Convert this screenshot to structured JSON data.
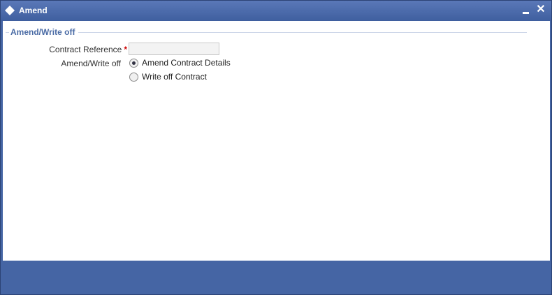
{
  "window": {
    "title": "Amend"
  },
  "fieldset": {
    "legend": "Amend/Write off"
  },
  "form": {
    "contract_reference": {
      "label": "Contract Reference",
      "required_mark": "*",
      "value": ""
    },
    "amend_write_off": {
      "label": "Amend/Write off",
      "options": [
        {
          "label": "Amend Contract Details",
          "selected": true
        },
        {
          "label": "Write off Contract",
          "selected": false
        }
      ]
    }
  },
  "colors": {
    "titlebar": "#3f5f9f",
    "footer": "#4565a4",
    "legend": "#4a6ba5",
    "required": "#cc0000"
  }
}
